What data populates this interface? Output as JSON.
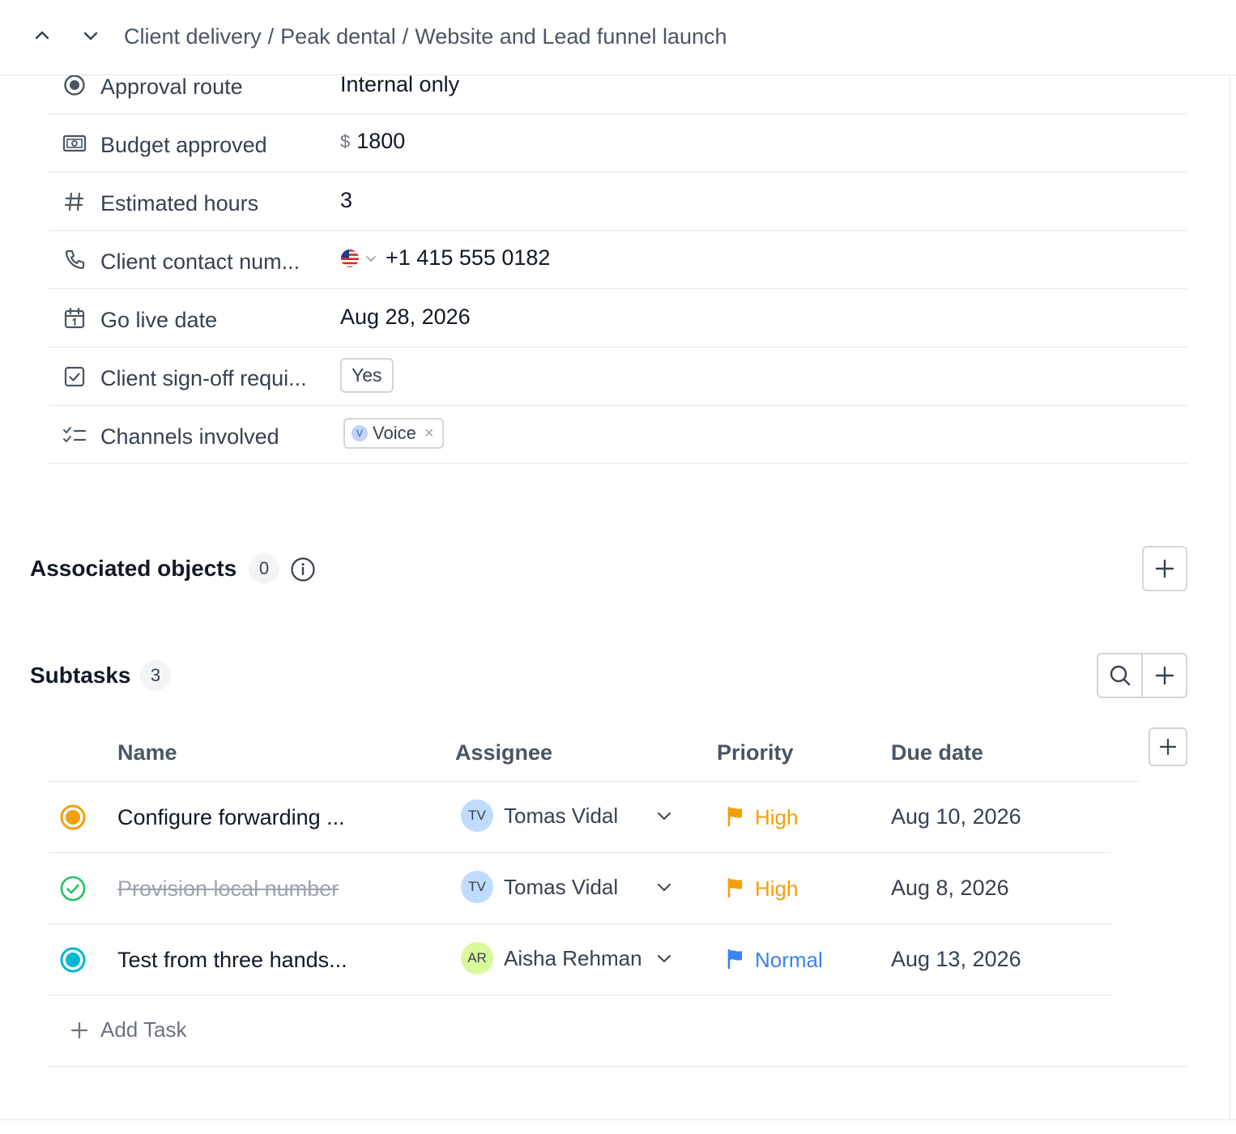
{
  "header": {
    "breadcrumb": [
      "Client delivery",
      "Peak dental",
      "Website and Lead funnel launch"
    ],
    "separator": "/"
  },
  "fields": {
    "approval_route": {
      "label": "Approval route",
      "value": "Internal only",
      "icon": "radio-icon"
    },
    "budget_approved": {
      "label": "Budget approved",
      "currency": "$",
      "value": "1800",
      "icon": "money-icon"
    },
    "estimated_hours": {
      "label": "Estimated hours",
      "value": "3",
      "icon": "hash-icon"
    },
    "client_contact": {
      "label": "Client contact num...",
      "value": "+1 415 555 0182",
      "icon": "phone-icon",
      "country_flag": "us-flag-icon"
    },
    "go_live_date": {
      "label": "Go live date",
      "value": "Aug 28, 2026",
      "icon": "calendar-icon"
    },
    "client_signoff": {
      "label": "Client sign-off requi...",
      "value": "Yes",
      "icon": "checkbox-icon"
    },
    "channels": {
      "label": "Channels involved",
      "chip_initial": "V",
      "chip_label": "Voice",
      "chip_remove": "×",
      "icon": "checklist-icon"
    }
  },
  "associated": {
    "title": "Associated objects",
    "count": "0"
  },
  "subtasks": {
    "title": "Subtasks",
    "count": "3",
    "columns": {
      "name": "Name",
      "assignee": "Assignee",
      "priority": "Priority",
      "due": "Due date"
    },
    "rows": [
      {
        "name": "Configure forwarding ...",
        "status": "in-progress",
        "status_color": "#f59e0b",
        "initials": "TV",
        "assignee": "Tomas Vidal",
        "avatar_color": "#bfdbfe",
        "priority": "High",
        "priority_color": "#f59e0b",
        "due": "Aug 10, 2026"
      },
      {
        "name": "Provision local number",
        "status": "done",
        "status_color": "#22c55e",
        "initials": "TV",
        "assignee": "Tomas Vidal",
        "avatar_color": "#bfdbfe",
        "priority": "High",
        "priority_color": "#f59e0b",
        "due": "Aug 8, 2026"
      },
      {
        "name": "Test from three hands...",
        "status": "open",
        "status_color": "#06b6d4",
        "initials": "AR",
        "assignee": "Aisha Rehman",
        "avatar_color": "#d9f99d",
        "priority": "Normal",
        "priority_color": "#3b82f6",
        "due": "Aug 13, 2026"
      }
    ],
    "add_task_label": "Add Task"
  }
}
